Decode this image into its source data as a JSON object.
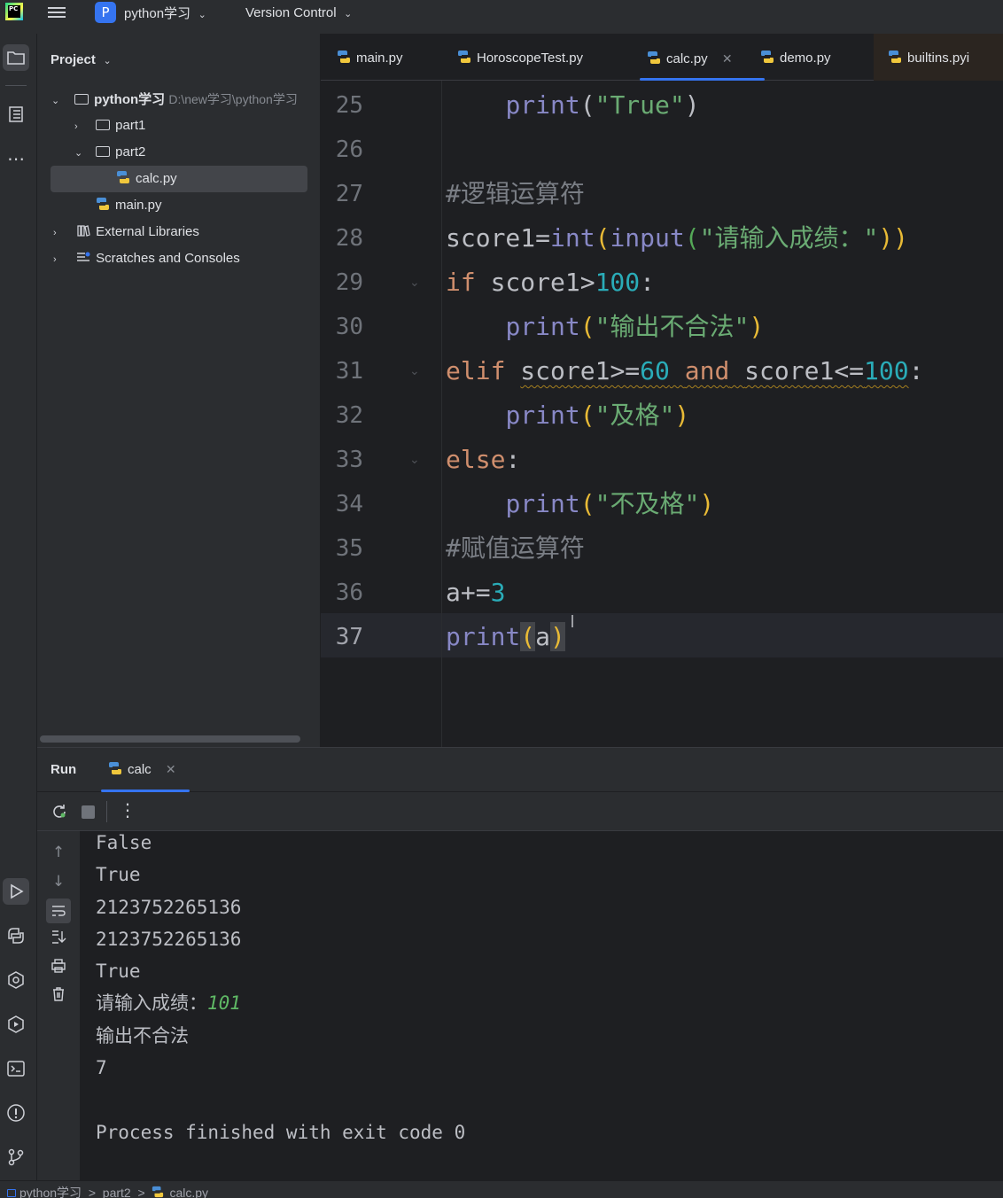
{
  "titlebar": {
    "app_logo": "PC",
    "project_badge": "P",
    "project_name": "python学习",
    "vcs": "Version Control"
  },
  "project_panel": {
    "title": "Project",
    "tree": [
      {
        "label": "python学习",
        "path": "D:\\new学习\\python学习"
      },
      {
        "label": "part1"
      },
      {
        "label": "part2"
      },
      {
        "label": "calc.py"
      },
      {
        "label": "main.py"
      },
      {
        "label": "External Libraries"
      },
      {
        "label": "Scratches and Consoles"
      }
    ]
  },
  "tabs": [
    {
      "label": "main.py"
    },
    {
      "label": "HoroscopeTest.py"
    },
    {
      "label": "calc.py",
      "active": true
    },
    {
      "label": "demo.py"
    },
    {
      "label": "builtins.pyi"
    }
  ],
  "editor": {
    "line_numbers": [
      "25",
      "26",
      "27",
      "28",
      "29",
      "30",
      "31",
      "32",
      "33",
      "34",
      "35",
      "36",
      "37"
    ],
    "current_line": "37",
    "tokens": {
      "l25": {
        "fn": "print",
        "p1": "(",
        "s": "\"True\"",
        "p2": ")"
      },
      "l27": {
        "c": "#逻辑运算符"
      },
      "l28": {
        "a": "score1=",
        "fn1": "int",
        "p1": "(",
        "fn2": "input",
        "p2": "(",
        "s": "\"请输入成绩：\"",
        "p3": "))"
      },
      "l29": {
        "kw": "if",
        "a": " score1>",
        "n": "100",
        "b": ":"
      },
      "l30": {
        "fn": "print",
        "p1": "(",
        "s": "\"输出不合法\"",
        "p2": ")"
      },
      "l31": {
        "kw": "elif",
        "a": "score1>=",
        "n1": "60",
        "kw2": "and",
        "b": "score1<=",
        "n2": "100",
        "c": ":"
      },
      "l32": {
        "fn": "print",
        "p1": "(",
        "s": "\"及格\"",
        "p2": ")"
      },
      "l33": {
        "kw": "else",
        "b": ":"
      },
      "l34": {
        "fn": "print",
        "p1": "(",
        "s": "\"不及格\"",
        "p2": ")"
      },
      "l35": {
        "c": "#赋值运算符"
      },
      "l36": {
        "a": "a+=",
        "n": "3"
      },
      "l37": {
        "fn": "print",
        "p1": "(",
        "a": "a",
        "p2": ")"
      }
    }
  },
  "run_panel": {
    "title": "Run",
    "tab": "calc",
    "output": [
      "False",
      "True",
      "2123752265136",
      "2123752265136",
      "True"
    ],
    "prompt": "请输入成绩：",
    "input_value": "101",
    "output2": [
      "输出不合法",
      "7"
    ],
    "finish": "Process finished with exit code 0"
  },
  "statusbar": {
    "crumbs": [
      "python学习",
      "part2",
      "calc.py"
    ],
    "separator": ">"
  },
  "colors": {
    "accent": "#3574f0",
    "keyword": "#cf8e6d",
    "builtin": "#8888c6",
    "string": "#6aab73",
    "number": "#2aacb8",
    "comment": "#7a7e85"
  }
}
